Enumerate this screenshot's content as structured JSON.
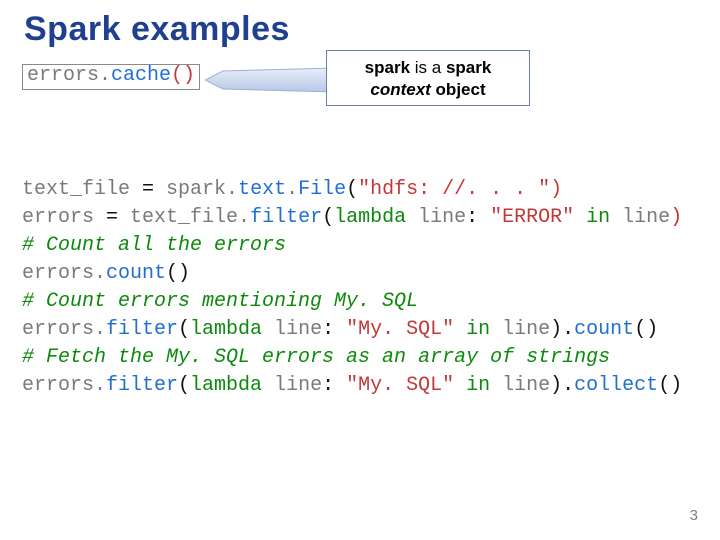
{
  "title": "Spark examples",
  "boxed_code": {
    "a": "errors.",
    "b": "cache",
    "c": "()"
  },
  "callout": {
    "line1_a": "spark",
    "line1_b": " is a ",
    "line1_c": "spark",
    "line2_a": "context",
    "line2_b": " object"
  },
  "code": {
    "l1_a": "text_file ",
    "l1_b": "= ",
    "l1_c": "spark.",
    "l1_d": "text",
    "l1_e": ".",
    "l1_f": "File",
    "l1_g": "(",
    "l1_h": "\"hdfs: //. . . \"",
    "l1_i": ")",
    "l2_a": "errors ",
    "l2_b": "= ",
    "l2_c": "text_file.",
    "l2_d": "filter",
    "l2_e": "(",
    "l2_f": "lambda ",
    "l2_g": "line",
    "l2_h": ": ",
    "l2_i": "\"ERROR\" ",
    "l2_j": "in ",
    "l2_k": "line",
    "l2_l": ")",
    "l3": "# Count all the errors",
    "l4_a": "errors.",
    "l4_b": "count",
    "l4_c": "()",
    "l5": "# Count errors mentioning My. SQL",
    "l6_a": "errors.",
    "l6_b": "filter",
    "l6_c": "(",
    "l6_d": "lambda ",
    "l6_e": "line",
    "l6_f": ": ",
    "l6_g": "\"My. SQL\" ",
    "l6_h": "in ",
    "l6_i": "line",
    "l6_j": ").",
    "l6_k": "count",
    "l6_l": "()",
    "l7": "# Fetch the My. SQL errors as an array of strings",
    "l8_a": "errors.",
    "l8_b": "filter",
    "l8_c": "(",
    "l8_d": "lambda ",
    "l8_e": "line",
    "l8_f": ": ",
    "l8_g": "\"My. SQL\" ",
    "l8_h": "in ",
    "l8_i": "line",
    "l8_j": ").",
    "l8_k": "collect",
    "l8_l": "()"
  },
  "page_number": "3"
}
